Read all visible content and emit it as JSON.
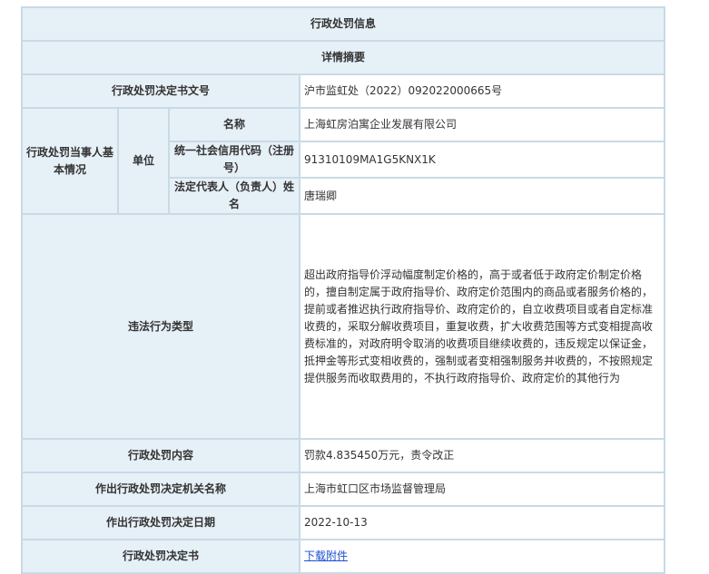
{
  "title": "行政处罚信息",
  "summary": "详情摘要",
  "rows": {
    "decision_no": {
      "label": "行政处罚决定书文号",
      "value": "沪市监虹处（2022）092022000665号"
    },
    "party": {
      "label": "行政处罚当事人基本情况",
      "unit_label": "单位",
      "name": {
        "label": "名称",
        "value": "上海虹房泊寓企业发展有限公司"
      },
      "credit_code": {
        "label": "统一社会信用代码（注册号）",
        "value": "91310109MA1G5KNX1K"
      },
      "legal_rep": {
        "label": "法定代表人（负责人）姓名",
        "value": "唐瑞卿"
      }
    },
    "violation_type": {
      "label": "违法行为类型",
      "value": "超出政府指导价浮动幅度制定价格的，高于或者低于政府定价制定价格的，擅自制定属于政府指导价、政府定价范围内的商品或者服务价格的，提前或者推迟执行政府指导价、政府定价的，自立收费项目或者自定标准收费的，采取分解收费项目，重复收费，扩大收费范围等方式变相提高收费标准的，对政府明令取消的收费项目继续收费的，违反规定以保证金，抵押金等形式变相收费的，强制或者变相强制服务并收费的，不按照规定提供服务而收取费用的，不执行政府指导价、政府定价的其他行为"
    },
    "penalty_content": {
      "label": "行政处罚内容",
      "value": "罚款4.835450万元，责令改正"
    },
    "authority": {
      "label": "作出行政处罚决定机关名称",
      "value": "上海市虹口区市场监督管理局"
    },
    "date": {
      "label": "作出行政处罚决定日期",
      "value": "2022-10-13"
    },
    "document": {
      "label": "行政处罚决定书",
      "link_text": "下载附件"
    }
  }
}
